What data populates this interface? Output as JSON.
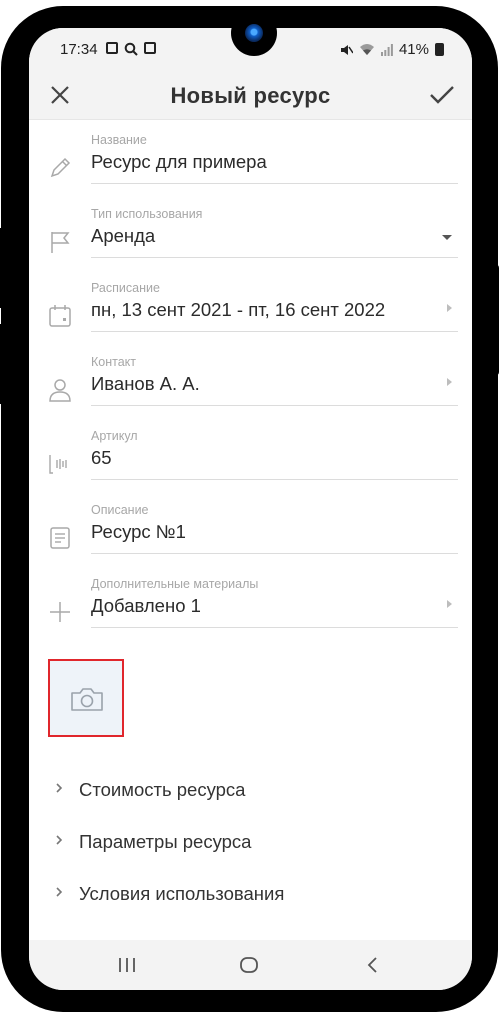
{
  "status_bar": {
    "time": "17:34",
    "battery": "41%",
    "left_icons": [
      "gallery-icon",
      "search-icon",
      "app-icon"
    ],
    "right_icons": [
      "mute-icon",
      "wifi-icon",
      "signal-icon",
      "battery-icon"
    ]
  },
  "appbar": {
    "title": "Новый ресурс",
    "close_icon": "close-icon",
    "save_icon": "check-icon"
  },
  "fields": [
    {
      "label": "Название",
      "value": "Ресурс для примера",
      "icon": "pencil-icon",
      "control": "none"
    },
    {
      "label": "Тип использования",
      "value": "Аренда",
      "icon": "flag-icon",
      "control": "dropdown"
    },
    {
      "label": "Расписание",
      "value": "пн, 13 сент 2021 - пт, 16 сент 2022",
      "icon": "calendar-icon",
      "control": "chevron"
    },
    {
      "label": "Контакт",
      "value": "Иванов А. А.",
      "icon": "person-icon",
      "control": "chevron"
    },
    {
      "label": "Артикул",
      "value": "65",
      "icon": "barcode-icon",
      "control": "none"
    },
    {
      "label": "Описание",
      "value": "Ресурс №1",
      "icon": "document-icon",
      "control": "none"
    },
    {
      "label": "Дополнительные материалы",
      "value": "Добавлено 1",
      "icon": "plus-icon",
      "control": "chevron"
    }
  ],
  "photo": {
    "icon": "camera-icon"
  },
  "sections": [
    {
      "label": "Стоимость ресурса"
    },
    {
      "label": "Параметры ресурса"
    },
    {
      "label": "Условия использования"
    }
  ],
  "navbar": {
    "icons": [
      "recent-apps-icon",
      "home-icon",
      "back-icon"
    ]
  },
  "colors": {
    "highlight_border": "#e0262c",
    "photo_bg": "#eef3f9",
    "label": "#a7a7a7",
    "text": "#2b2b2b"
  }
}
